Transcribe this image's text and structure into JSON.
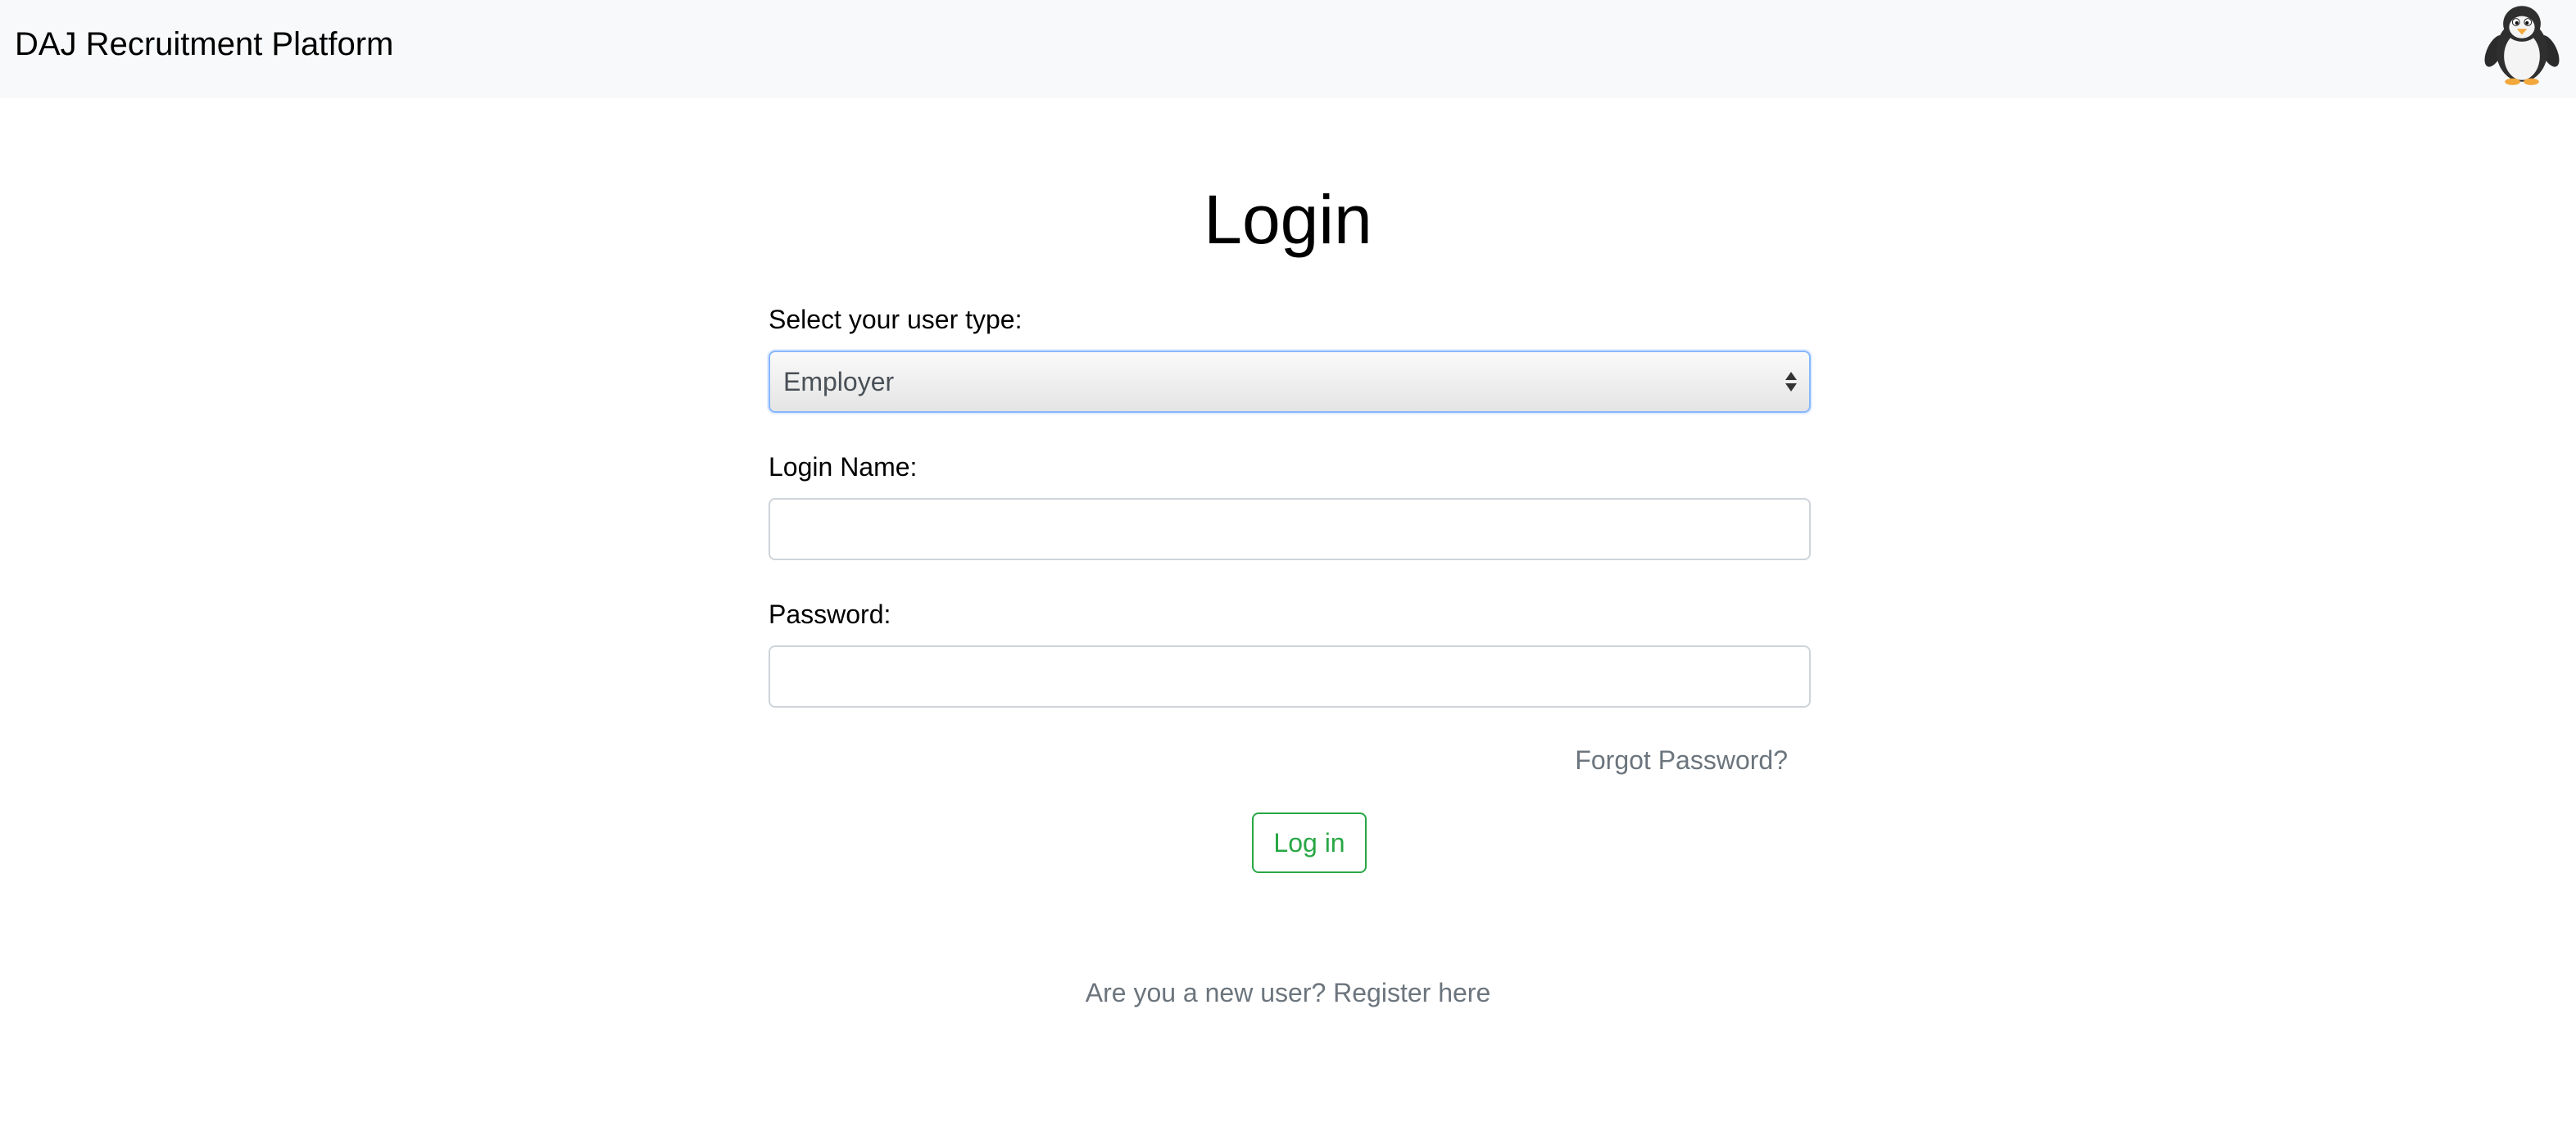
{
  "navbar": {
    "brand": "DAJ Recruitment Platform",
    "mascot_icon": "penguin-icon"
  },
  "login": {
    "title": "Login",
    "user_type_label": "Select your user type:",
    "user_type_value": "Employer",
    "login_name_label": "Login Name:",
    "login_name_value": "",
    "password_label": "Password:",
    "password_value": "",
    "forgot_password": "Forgot Password?",
    "submit_label": "Log in",
    "register_text": "Are you a new user? Register here"
  },
  "colors": {
    "navbar_bg": "#f8f9fa",
    "success": "#28a745",
    "muted": "#6c757d",
    "focus_border": "#86b7fe"
  }
}
